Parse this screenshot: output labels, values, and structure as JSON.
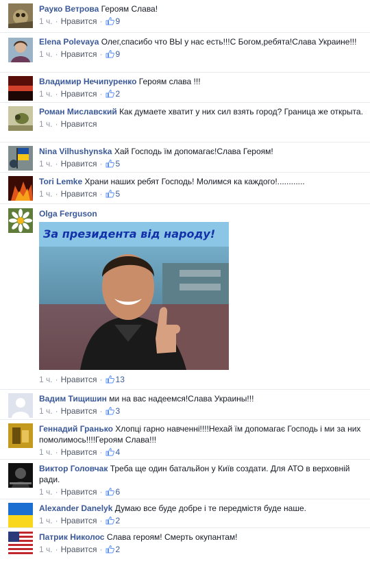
{
  "comments": [
    {
      "author": "Рауко Ветрова",
      "text": "Героям Слава!",
      "time": "1 ч.",
      "like_label": "Нравится",
      "likes": "9",
      "avatar_icon": "avatar-owl-photo"
    },
    {
      "author": "Elena Polevaya",
      "text": "Олег,спасибо что ВЫ у нас есть!!!С Богом,ребята!Слава Украине!!!",
      "time": "1 ч.",
      "like_label": "Нравится",
      "likes": "9",
      "avatar_icon": "avatar-portrait-photo"
    },
    {
      "author": "Владимир Нечипуренко",
      "text": "Героям слава !!!",
      "time": "1 ч.",
      "like_label": "Нравится",
      "likes": "2",
      "avatar_icon": "avatar-red-sunset-photo"
    },
    {
      "author": "Роман Миславский",
      "text": "Как думаете хватит у них сил взять город? Граница же открыта.",
      "time": "1 ч.",
      "like_label": "Нравится",
      "likes": "",
      "avatar_icon": "avatar-nature-photo"
    },
    {
      "author": "Nina Vilhushynska",
      "text": "Хай Господь їм допомагає!Слава Героям!",
      "time": "1 ч.",
      "like_label": "Нравится",
      "likes": "5",
      "avatar_icon": "avatar-flag-photo"
    },
    {
      "author": "Tori Lemke",
      "text": "Храни наших ребят Господь! Молимся ка каждого!............",
      "time": "1 ч.",
      "like_label": "Нравится",
      "likes": "5",
      "avatar_icon": "avatar-fire-photo"
    },
    {
      "author": "Olga Ferguson",
      "text": "",
      "time": "1 ч.",
      "like_label": "Нравится",
      "likes": "13",
      "avatar_icon": "avatar-daisy-photo",
      "photo": {
        "caption": "За президента від народу!",
        "bg": "#2e86c1"
      }
    },
    {
      "author": "Вадим Тищишин",
      "text": "ми на вас надеемся!Слава Украины!!!",
      "time": "1 ч.",
      "like_label": "Нравится",
      "likes": "3",
      "avatar_icon": "avatar-default-silhouette"
    },
    {
      "author": "Геннадий Гранько",
      "text": "Хлопці гарно навченні!!!!Нехай їм допомагає Господь і ми за них помолимось!!!!Героям Слава!!!",
      "time": "1 ч.",
      "like_label": "Нравится",
      "likes": "4",
      "avatar_icon": "avatar-gold-photo"
    },
    {
      "author": "Виктор Головчак",
      "text": "Треба ще один батальйон у Київ создати. Для АТО в верховній ради.",
      "time": "1 ч.",
      "like_label": "Нравится",
      "likes": "6",
      "avatar_icon": "avatar-dark-photo"
    },
    {
      "author": "Alexander Danelyk",
      "text": "Думаю все буде добре і те передмістя буде наше.",
      "time": "1 ч.",
      "like_label": "Нравится",
      "likes": "2",
      "avatar_icon": "avatar-ukraine-flag"
    },
    {
      "author": "Патрик Николос",
      "text": "Слава героям! Смерть окупантам!",
      "time": "1 ч.",
      "like_label": "Нравится",
      "likes": "2",
      "avatar_icon": "avatar-us-flag"
    }
  ],
  "colors": {
    "link": "#3b5998",
    "meta": "#9197a3",
    "border": "#e9eaed"
  }
}
